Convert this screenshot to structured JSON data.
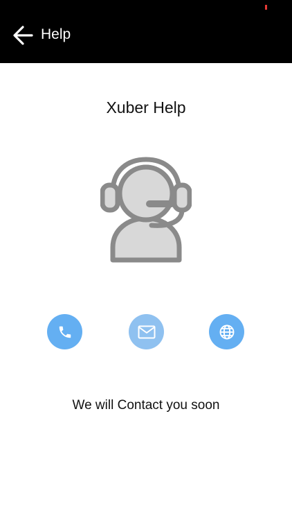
{
  "header": {
    "title": "Help",
    "background": "#000000",
    "back_icon": "arrow-left-icon"
  },
  "main": {
    "title": "Xuber Help",
    "illustration_icon": "support-agent-headset-icon",
    "contact_actions": [
      {
        "name": "call",
        "icon": "phone-icon",
        "color": "#64aff2"
      },
      {
        "name": "email",
        "icon": "mail-icon",
        "color": "#8fc1f0"
      },
      {
        "name": "website",
        "icon": "globe-icon",
        "color": "#64aff2"
      }
    ],
    "message": "We will Contact you soon"
  }
}
